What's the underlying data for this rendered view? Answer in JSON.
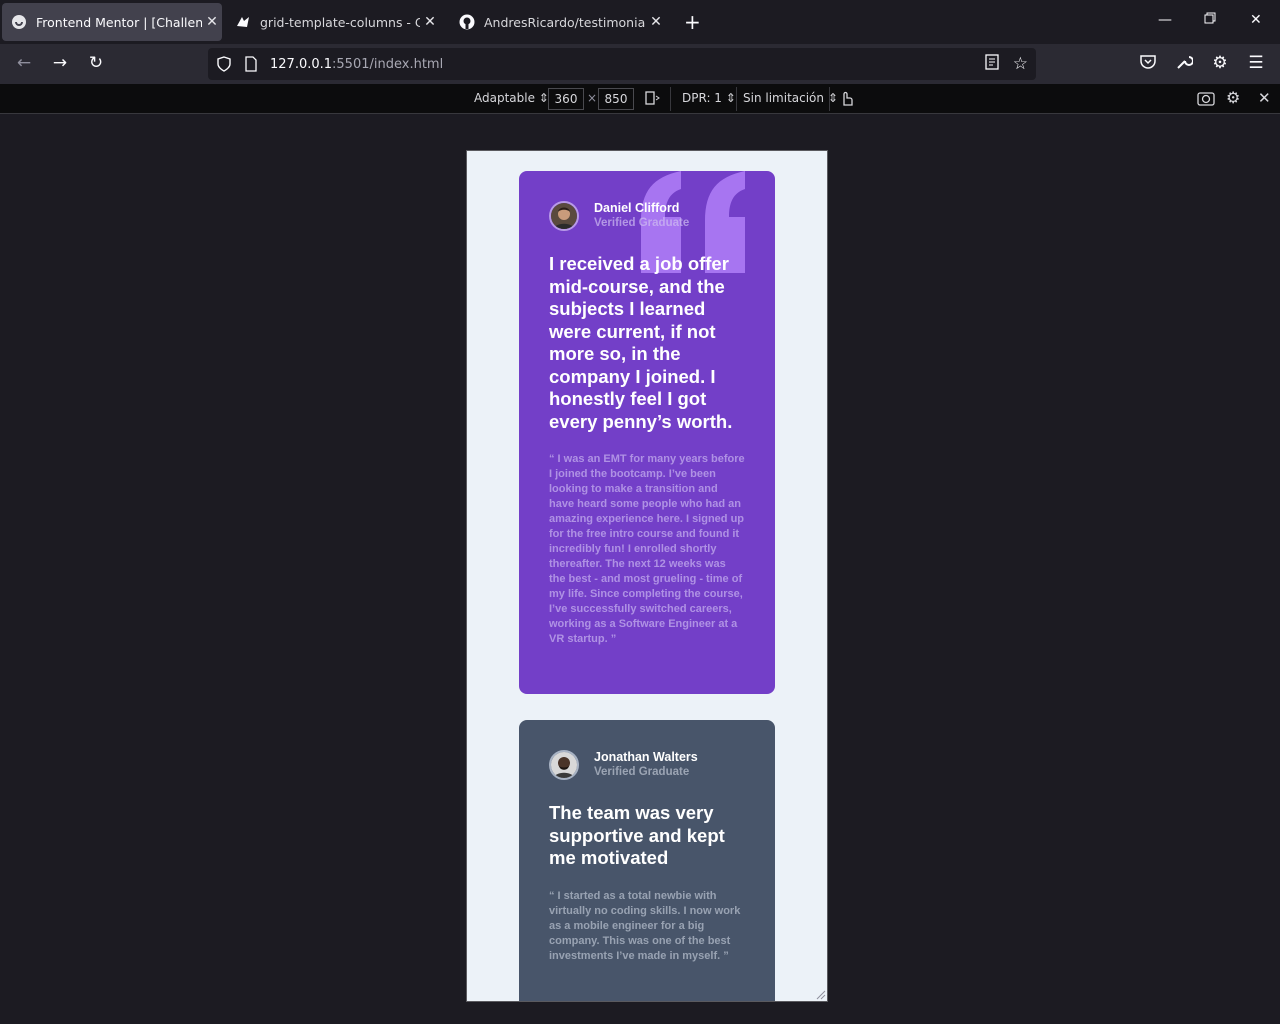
{
  "browser": {
    "tabs": [
      {
        "title": "Frontend Mentor | [Challenge N",
        "active": true,
        "icon": "frontend-mentor-icon"
      },
      {
        "title": "grid-template-columns - CSS | M",
        "active": false,
        "icon": "mdn-icon"
      },
      {
        "title": "AndresRicardo/testimonials-grid",
        "active": false,
        "icon": "github-icon"
      }
    ],
    "url_host": "127.0.0.1",
    "url_rest": ":5501/index.html"
  },
  "rdm": {
    "device": "Adaptable",
    "width": "360",
    "times": "×",
    "height": "850",
    "dpr": "DPR: 1",
    "throttle": "Sin limitación"
  },
  "testimonials": [
    {
      "name": "Daniel Clifford",
      "role": "Verified Graduate",
      "headline": "I received a job offer mid-course, and the subjects I learned were current, if not more so, in the company I joined. I honestly feel I got every penny’s worth.",
      "body": "“ I was an EMT for many years before I joined the bootcamp. I’ve been looking to make a transition and have heard some people who had an amazing experience here. I signed up for the free intro course and found it incredibly fun! I enrolled shortly thereafter. The next 12 weeks was the best - and most grueling - time of my life. Since completing the course, I’ve successfully switched careers, working as a Software Engineer at a VR startup. ”"
    },
    {
      "name": "Jonathan Walters",
      "role": "Verified Graduate",
      "headline": "The team was very supportive and kept me motivated",
      "body": "“ I started as a total newbie with virtually no coding skills. I now work as a mobile engineer for a big company. This was one of the best investments I’ve made in myself. ”"
    }
  ],
  "colors": {
    "purple_card": "#733fc8",
    "slate_card": "#48556a",
    "page_bg": "#ecf2f8"
  }
}
